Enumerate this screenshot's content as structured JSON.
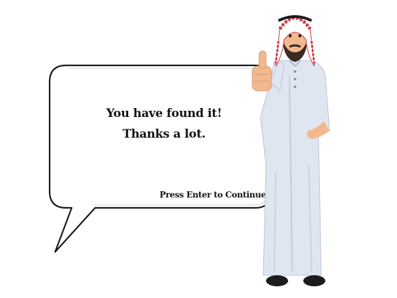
{
  "dialog": {
    "line1": "You have found it!",
    "line2": "Thanks a lot.",
    "continue_prompt": "Press Enter to Continue"
  },
  "character": {
    "icon": "arab-man-thumbs-up-icon"
  },
  "colors": {
    "background": "#ffffff",
    "bubble_fill": "#ffffff",
    "bubble_stroke": "#1a1a1a",
    "thobe": "#dfe6f2",
    "thobe_shade": "#b8c3d6",
    "ghutra_red": "#c7343b",
    "skin": "#f2b98f",
    "beard": "#3a2a22",
    "shoes": "#1c1c1c"
  }
}
